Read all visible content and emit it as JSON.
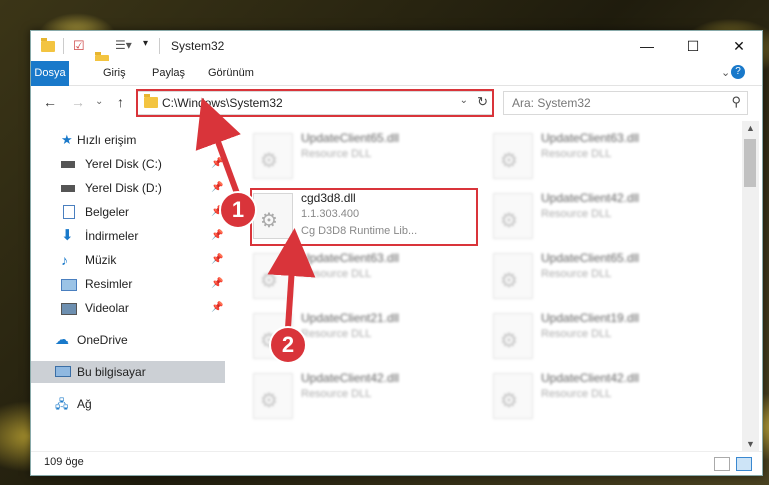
{
  "window": {
    "title": "System32",
    "controls": {
      "minimize": "—",
      "maximize": "☐",
      "close": "✕"
    }
  },
  "ribbon": {
    "tabs": [
      "Dosya",
      "Giriş",
      "Paylaş",
      "Görünüm"
    ],
    "expand": "⌄",
    "help": "?"
  },
  "nav": {
    "back": "←",
    "forward": "→",
    "dropdown": "⌄",
    "up": "↑",
    "address": "C:\\Windows\\System32",
    "refresh": "↻",
    "search_placeholder": "Ara: System32"
  },
  "sidebar": {
    "items": [
      {
        "label": "Hızlı erişim",
        "icon": "star-icon"
      },
      {
        "label": "Yerel Disk (C:)",
        "icon": "drive-icon",
        "pinned": true
      },
      {
        "label": "Yerel Disk (D:)",
        "icon": "drive-icon",
        "pinned": true
      },
      {
        "label": "Belgeler",
        "icon": "documents-icon",
        "pinned": true
      },
      {
        "label": "İndirmeler",
        "icon": "download-icon",
        "pinned": true
      },
      {
        "label": "Müzik",
        "icon": "music-icon",
        "pinned": true
      },
      {
        "label": "Resimler",
        "icon": "pictures-icon",
        "pinned": true
      },
      {
        "label": "Videolar",
        "icon": "videos-icon",
        "pinned": true
      },
      {
        "label": "OneDrive",
        "icon": "cloud-icon"
      },
      {
        "label": "Bu bilgisayar",
        "icon": "computer-icon",
        "selected": true
      },
      {
        "label": "Ağ",
        "icon": "network-icon"
      }
    ]
  },
  "files": [
    {
      "name": "UpdateClient65.dll",
      "line2": "Resource DLL"
    },
    {
      "name": "UpdateClient63.dll",
      "line2": "Resource DLL"
    },
    {
      "name": "cgd3d8.dll",
      "line2": "1.1.303.400",
      "line3": "Cg D3D8 Runtime Lib..."
    },
    {
      "name": "UpdateClient42.dll",
      "line2": "Resource DLL"
    },
    {
      "name": "UpdateClient63.dll",
      "line2": "Resource DLL"
    },
    {
      "name": "UpdateClient65.dll",
      "line2": "Resource DLL"
    },
    {
      "name": "UpdateClient21.dll",
      "line2": "Resource DLL"
    },
    {
      "name": "UpdateClient19.dll",
      "line2": "Resource DLL"
    },
    {
      "name": "UpdateClient42.dll",
      "line2": "Resource DLL"
    },
    {
      "name": "UpdateClient42.dll",
      "line2": "Resource DLL"
    }
  ],
  "status": {
    "count": "109 öge"
  },
  "annotations": {
    "badge1": "1",
    "badge2": "2"
  },
  "colors": {
    "accent": "#1979ca",
    "highlight": "#d9343a"
  }
}
